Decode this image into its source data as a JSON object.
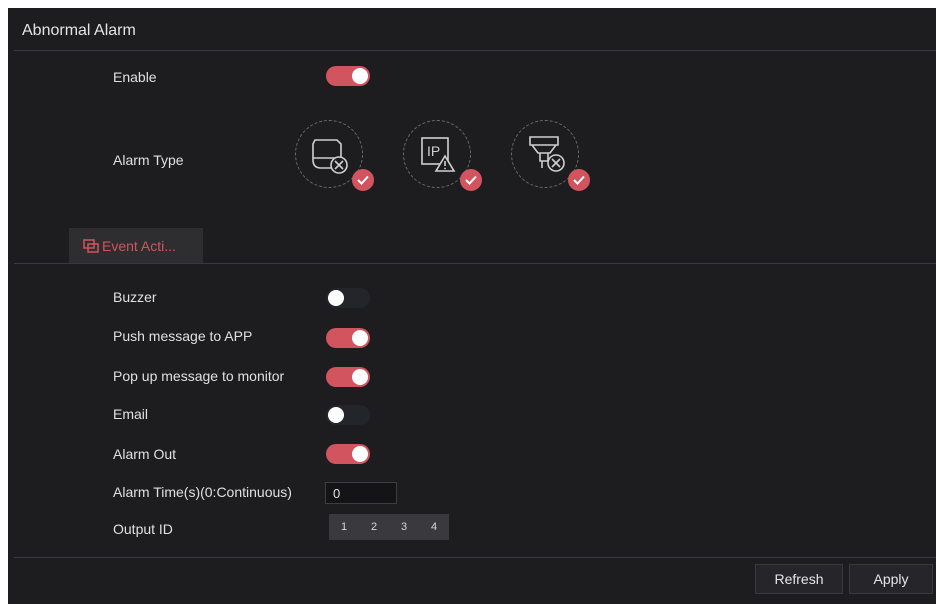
{
  "page": {
    "title": "Abnormal Alarm"
  },
  "colors": {
    "accent": "#d2545f",
    "background": "#1d1d1f",
    "toggle_off": "#24252b"
  },
  "enable": {
    "label": "Enable",
    "on": true
  },
  "alarm_type": {
    "label": "Alarm Type",
    "options": [
      {
        "icon": "hdd-error-icon",
        "checked": true
      },
      {
        "icon": "ip-conflict-icon",
        "checked": true
      },
      {
        "icon": "network-disconnected-icon",
        "checked": true
      }
    ]
  },
  "tab": {
    "label": "Event Acti...",
    "icon": "event-action-icon"
  },
  "actions": {
    "buzzer": {
      "label": "Buzzer",
      "on": false
    },
    "push_app": {
      "label": "Push message to APP",
      "on": true
    },
    "popup_monitor": {
      "label": "Pop up message to monitor",
      "on": true
    },
    "email": {
      "label": "Email",
      "on": false
    },
    "alarm_out": {
      "label": "Alarm Out",
      "on": true
    }
  },
  "alarm_time": {
    "label": "Alarm Time(s)(0:Continuous)",
    "value": "0"
  },
  "output_id": {
    "label": "Output ID",
    "ids": [
      "1",
      "2",
      "3",
      "4"
    ]
  },
  "buttons": {
    "refresh": "Refresh",
    "apply": "Apply"
  }
}
